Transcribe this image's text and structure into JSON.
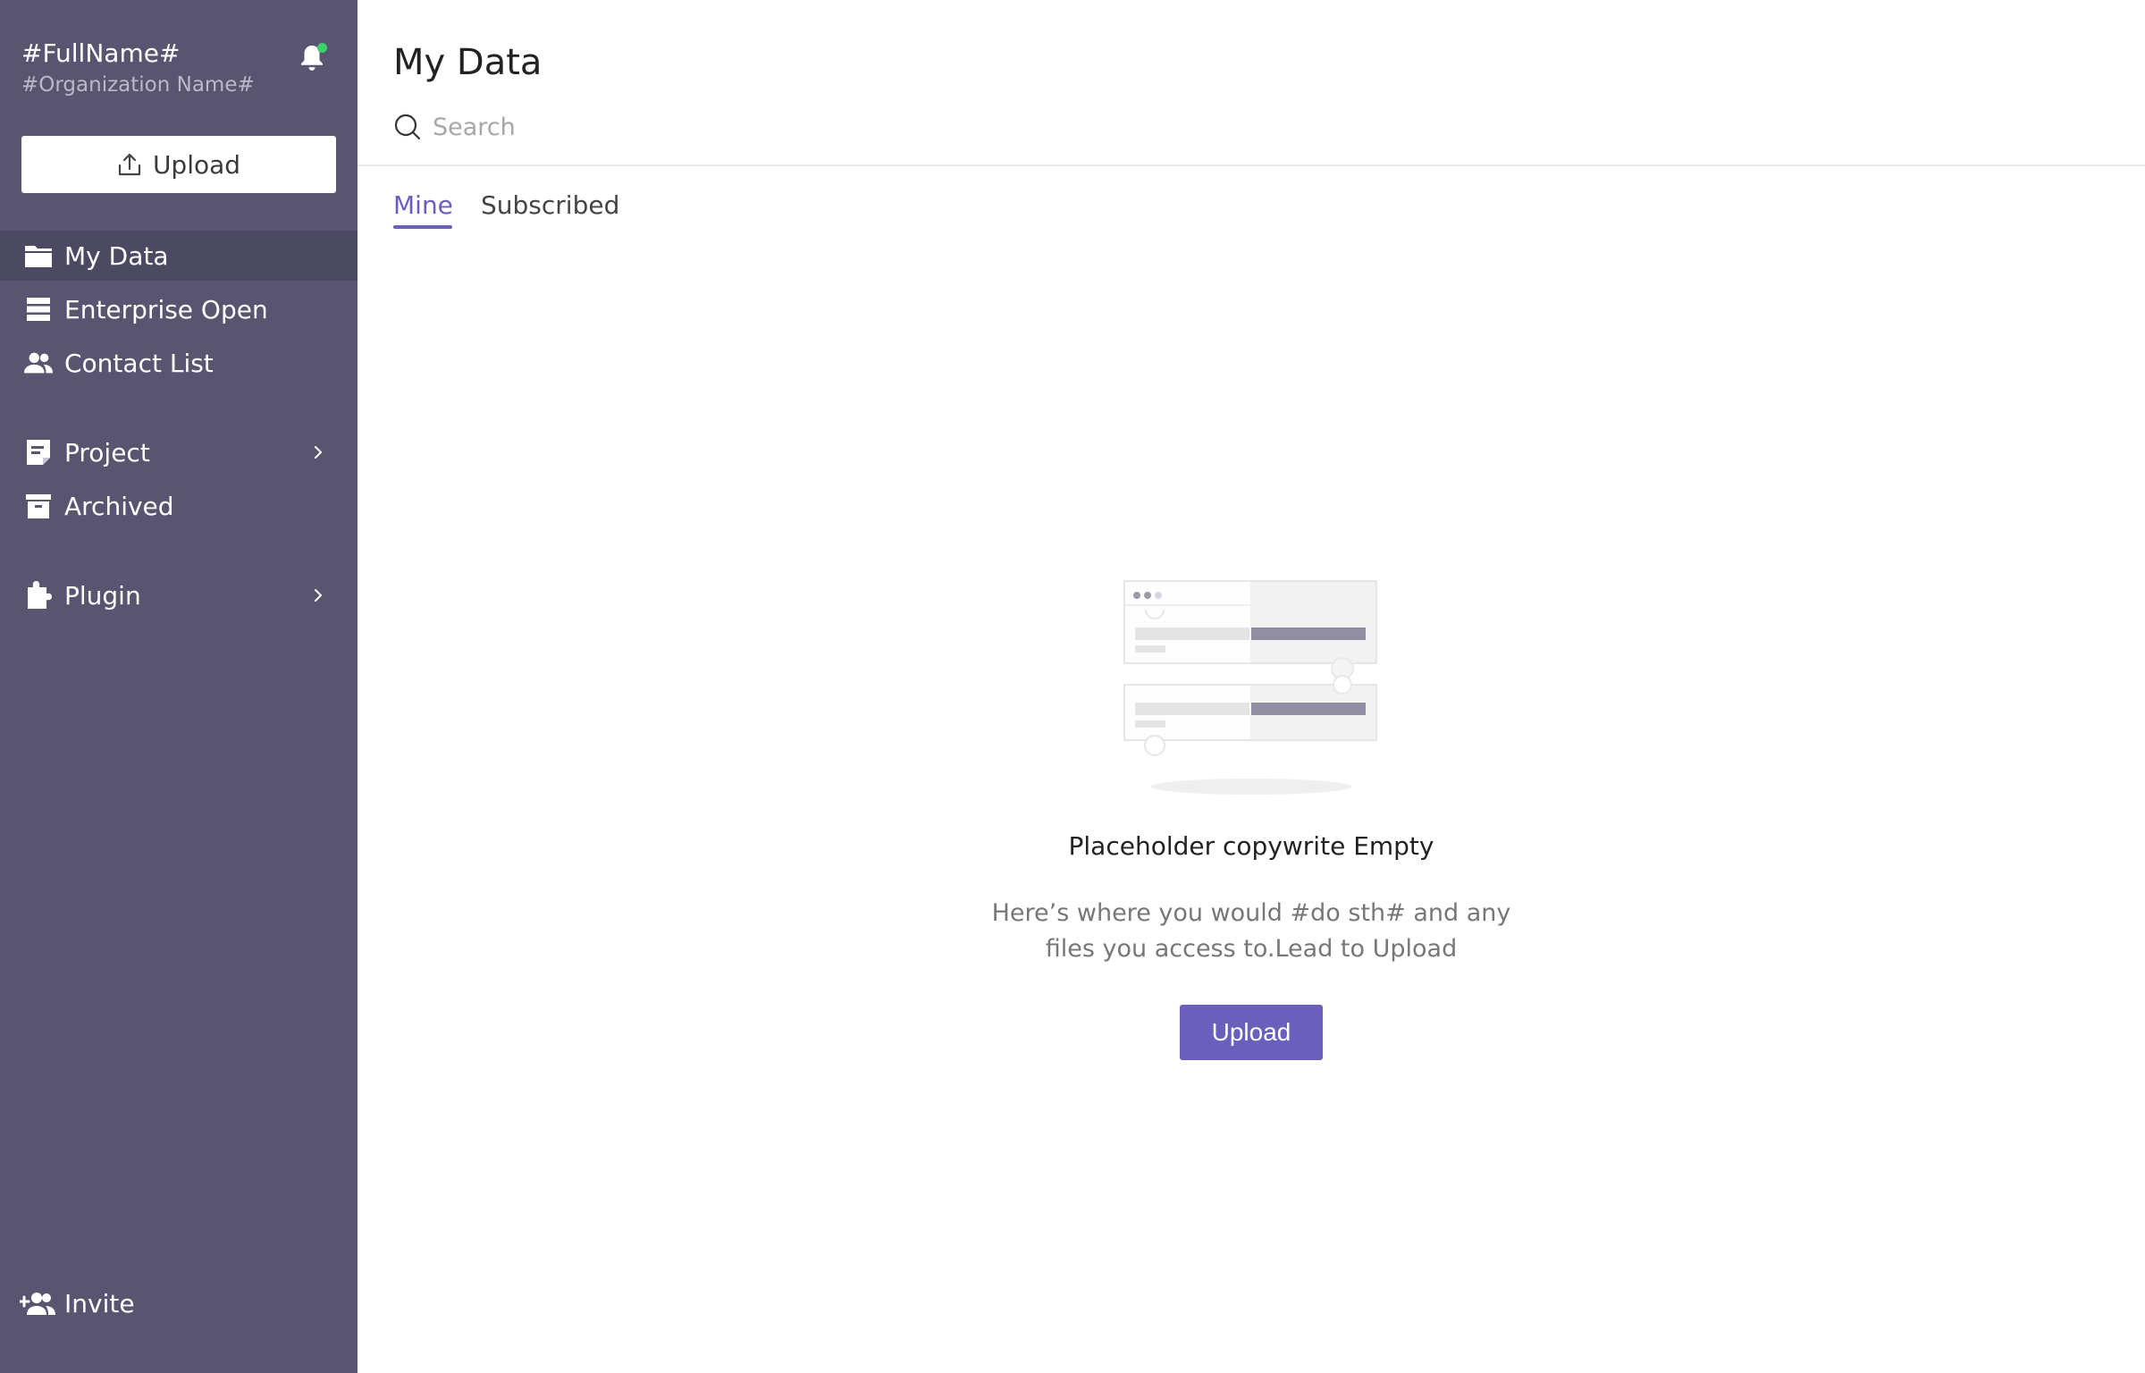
{
  "user": {
    "full_name": "#FullName#",
    "organization": "#Organization Name#"
  },
  "sidebar": {
    "upload_label": "Upload",
    "items": [
      {
        "label": "My Data",
        "icon": "folder-icon",
        "active": true
      },
      {
        "label": "Enterprise Open",
        "icon": "server-icon"
      },
      {
        "label": "Contact List",
        "icon": "contacts-icon"
      },
      {
        "label": "Project",
        "icon": "project-icon",
        "has_submenu": true
      },
      {
        "label": "Archived",
        "icon": "archive-icon"
      },
      {
        "label": "Plugin",
        "icon": "puzzle-icon",
        "has_submenu": true
      }
    ],
    "invite_label": "Invite"
  },
  "main": {
    "title": "My Data",
    "search": {
      "placeholder": "Search",
      "value": ""
    },
    "tabs": [
      {
        "label": "Mine",
        "active": true
      },
      {
        "label": "Subscribed",
        "active": false
      }
    ],
    "empty_state": {
      "title": "Placeholder copywrite Empty",
      "description_line1": "Here’s where you would #do sth# and any",
      "description_line2": "files you access to.Lead to Upload",
      "button_label": "Upload"
    }
  },
  "colors": {
    "sidebar_bg": "#595570",
    "sidebar_active": "#4c4962",
    "accent": "#6b5fbd",
    "notification_dot": "#3ccf6e"
  }
}
